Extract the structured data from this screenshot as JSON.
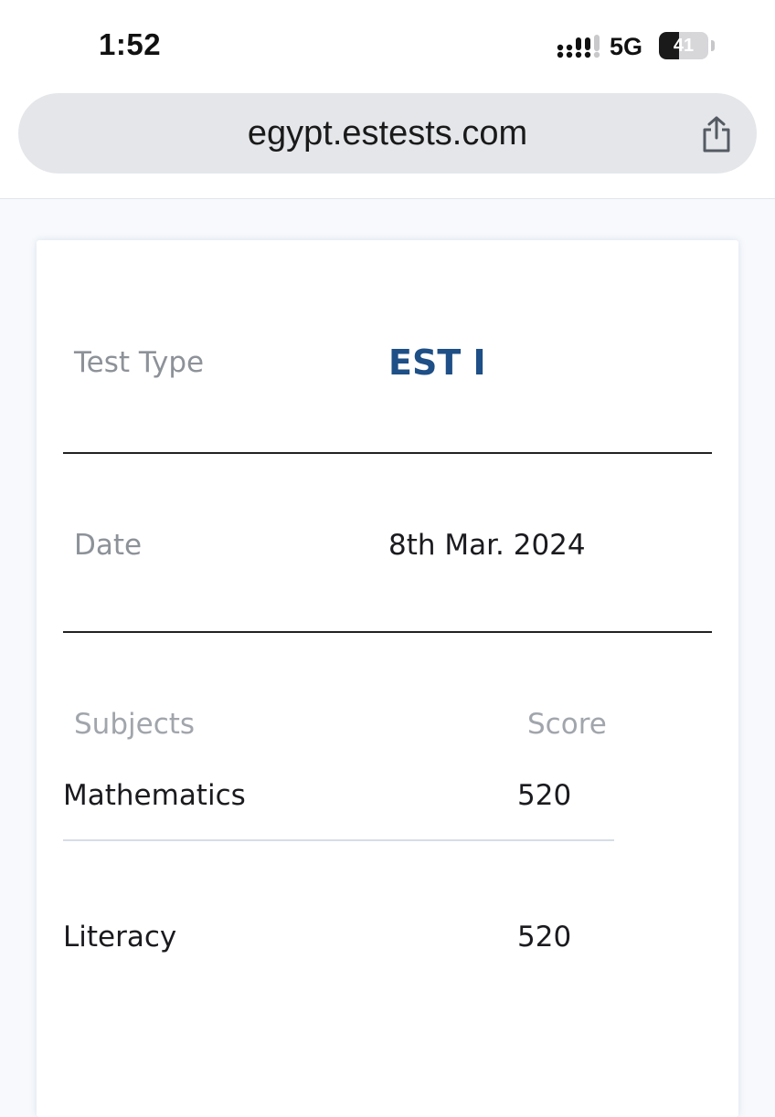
{
  "status_bar": {
    "time": "1:52",
    "network": "5G",
    "battery_level": "41",
    "battery_fraction": 0.41,
    "signal_icon": "signal-bars-icon"
  },
  "browser": {
    "url": "egypt.estests.com",
    "share_icon": "share-icon"
  },
  "result": {
    "test_type_label": "Test Type",
    "test_type_value": "EST I",
    "date_label": "Date",
    "date_value": "8th Mar. 2024",
    "columns": {
      "subjects": "Subjects",
      "score": "Score"
    },
    "rows": [
      {
        "subject": "Mathematics",
        "score": "520"
      },
      {
        "subject": "Literacy",
        "score": "520"
      }
    ]
  },
  "colors": {
    "accent": "#1e4f86",
    "label_gray": "#8d9299",
    "page_background": "#f7f9fc"
  }
}
